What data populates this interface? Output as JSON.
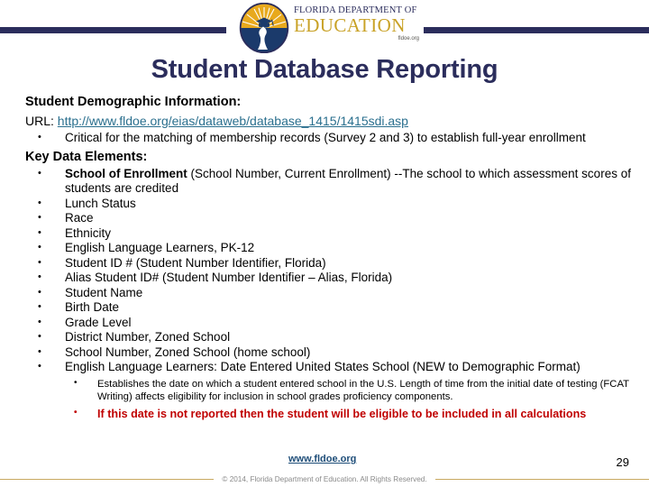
{
  "brand": {
    "logo_line1": "FLORIDA DEPARTMENT OF",
    "logo_line2": "EDUCATION",
    "logo_line3": "fldoe.org",
    "navy": "#2b2d5c",
    "gold": "#c9a227",
    "red": "#c00000",
    "link_blue": "#2a6f8e"
  },
  "slide": {
    "title": "Student Database Reporting",
    "section_heading": "Student Demographic Information:",
    "url_label": "URL:",
    "url": "http://www.fldoe.org/eias/dataweb/database_1415/1415sdi.asp",
    "intro_bullet": "Critical for the matching of membership records (Survey 2 and 3) to establish full-year enrollment",
    "key_heading": "Key Data Elements:",
    "key_elements": [
      {
        "lead": "School of Enrollment",
        "rest": " (School Number, Current Enrollment) --The school to which assessment scores of students are credited"
      },
      {
        "lead": "",
        "rest": "Lunch Status"
      },
      {
        "lead": "",
        "rest": "Race"
      },
      {
        "lead": "",
        "rest": "Ethnicity"
      },
      {
        "lead": "",
        "rest": "English Language Learners, PK-12"
      },
      {
        "lead": "",
        "rest": "Student ID # (Student Number Identifier, Florida)"
      },
      {
        "lead": "",
        "rest": "Alias Student ID# (Student Number Identifier – Alias, Florida)"
      },
      {
        "lead": "",
        "rest": "Student Name"
      },
      {
        "lead": "",
        "rest": "Birth Date"
      },
      {
        "lead": "",
        "rest": "Grade Level"
      },
      {
        "lead": "",
        "rest": "District Number, Zoned School"
      },
      {
        "lead": "",
        "rest": "School Number, Zoned School (home school)"
      },
      {
        "lead": "",
        "rest": "English Language Learners: Date Entered United States School (NEW to Demographic Format)"
      }
    ],
    "sub_bullets": [
      {
        "text": "Establishes the date on which a student entered school in the U.S. Length of time from the initial date of testing (FCAT Writing) affects eligibility for inclusion in school grades proficiency components.",
        "emphasis": false
      },
      {
        "text": "If this date is not reported then the student will be eligible to be included in all calculations",
        "emphasis": true
      }
    ]
  },
  "footer": {
    "site_link": "www.fldoe.org",
    "page_number": "29",
    "copyright": "© 2014, Florida Department of Education. All Rights Reserved."
  }
}
